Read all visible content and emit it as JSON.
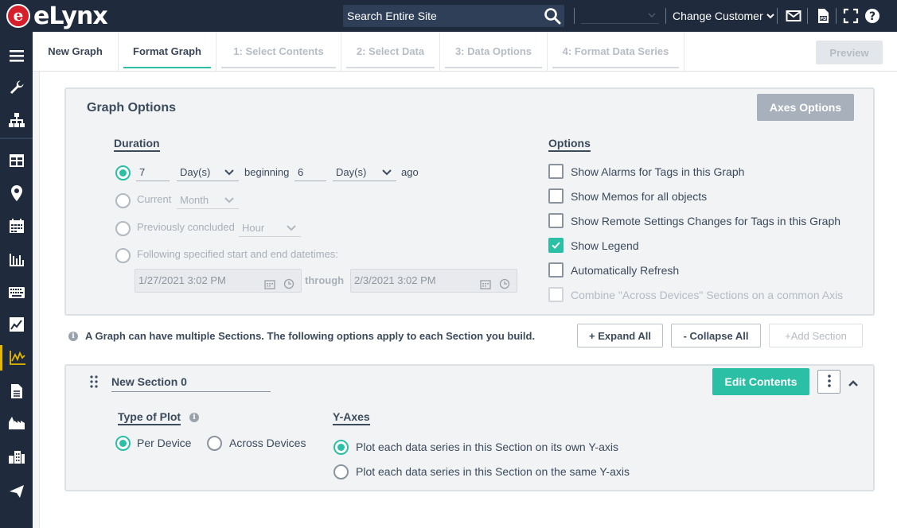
{
  "app": {
    "logo_letter": "e",
    "logo_text": "eLynx",
    "brand_color": "#d61f2a",
    "accent_color": "#2bbfa6"
  },
  "header": {
    "search_placeholder": "Search Entire Site",
    "change_customer": "Change Customer",
    "icons": [
      "search-icon",
      "mail-icon",
      "export-pdf-icon",
      "fullscreen-icon",
      "help-icon"
    ]
  },
  "sidebar": {
    "items": [
      "menu-icon",
      "wrench-icon",
      "hierarchy-icon",
      "grid-icon",
      "location-pin-icon",
      "calendar-icon",
      "bar-chart-icon",
      "keyboard-icon",
      "line-chart-icon",
      "trend-graph-icon",
      "document-icon",
      "facility-icon",
      "building-icon",
      "send-icon"
    ],
    "active": "trend-graph-icon"
  },
  "tabs": [
    {
      "label": "New Graph",
      "state": "dark"
    },
    {
      "label": "Format Graph",
      "state": "active"
    },
    {
      "label": "1: Select Contents",
      "state": "disabled"
    },
    {
      "label": "2: Select Data",
      "state": "disabled"
    },
    {
      "label": "3: Data Options",
      "state": "disabled"
    },
    {
      "label": "4: Format Data Series",
      "state": "disabled"
    }
  ],
  "preview_label": "Preview",
  "graph_options": {
    "title": "Graph Options",
    "axes_button": "Axes Options",
    "duration": {
      "label": "Duration",
      "relative": {
        "count": "7",
        "unit": "Day(s)",
        "word_beginning": "beginning",
        "offset": "6",
        "offset_unit": "Day(s)",
        "word_ago": "ago"
      },
      "current": {
        "label": "Current",
        "unit": "Month"
      },
      "previous": {
        "label": "Previously concluded",
        "unit": "Hour"
      },
      "following": {
        "label": "Following specified start and end datetimes:",
        "start": "1/27/2021 3:02 PM",
        "through": "through",
        "end": "2/3/2021 3:02 PM"
      }
    },
    "options": {
      "label": "Options",
      "items": [
        {
          "label": "Show Alarms for Tags in this Graph",
          "checked": false,
          "disabled": false
        },
        {
          "label": "Show Memos for all objects",
          "checked": false,
          "disabled": false
        },
        {
          "label": "Show Remote Settings Changes for Tags in this Graph",
          "checked": false,
          "disabled": false
        },
        {
          "label": "Show Legend",
          "checked": true,
          "disabled": false
        },
        {
          "label": "Automatically Refresh",
          "checked": false,
          "disabled": false
        },
        {
          "label": "Combine \"Across Devices\" Sections on a common Axis",
          "checked": false,
          "disabled": true
        }
      ]
    }
  },
  "sections_info": {
    "text": "A Graph can have multiple Sections. The following options apply to each Section you build.",
    "expand_all": "+ Expand All",
    "collapse_all": "- Collapse All",
    "add_section": "+Add Section"
  },
  "section": {
    "name": "New Section 0",
    "edit_contents": "Edit Contents",
    "type_of_plot": {
      "label": "Type of Plot",
      "options": [
        "Per Device",
        "Across Devices"
      ],
      "selected": "Per Device"
    },
    "y_axes": {
      "label": "Y-Axes",
      "options": [
        "Plot each data series in this Section on its own Y-axis",
        "Plot each data series in this Section on the same Y-axis"
      ],
      "selected": "Plot each data series in this Section on its own Y-axis"
    }
  }
}
